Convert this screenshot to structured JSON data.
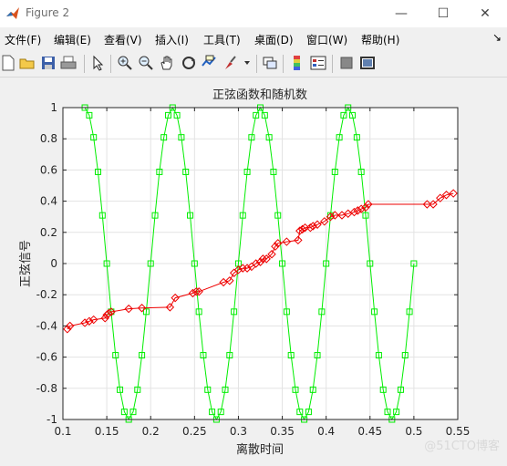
{
  "window": {
    "title": "Figure 2",
    "minimize_glyph": "—",
    "maximize_glyph": "☐",
    "close_glyph": "✕"
  },
  "menu": {
    "items": [
      "文件(F)",
      "编辑(E)",
      "查看(V)",
      "插入(I)",
      "工具(T)",
      "桌面(D)",
      "窗口(W)",
      "帮助(H)"
    ],
    "overflow_glyph": "↘"
  },
  "toolbar": {
    "icons": [
      "new-figure-icon",
      "open-file-icon",
      "save-icon",
      "print-icon",
      "pointer-icon",
      "zoom-in-icon",
      "zoom-out-icon",
      "pan-hand-icon",
      "rotate-3d-icon",
      "data-cursor-icon",
      "brush-icon",
      "link-plot-icon",
      "colorbar-icon",
      "legend-icon",
      "hide-plot-tools-icon",
      "show-plot-tools-icon"
    ]
  },
  "watermark": "@51CTO博客",
  "chart_data": {
    "type": "line",
    "title": "正弦函数和随机数",
    "xlabel": "离散时间",
    "ylabel": "正弦信号",
    "xlim": [
      0.1,
      0.55
    ],
    "ylim": [
      -1,
      1
    ],
    "xticks": [
      0.1,
      0.15,
      0.2,
      0.25,
      0.3,
      0.35,
      0.4,
      0.45,
      0.5,
      0.55
    ],
    "yticks": [
      -1,
      -0.8,
      -0.6,
      -0.4,
      -0.2,
      0,
      0.2,
      0.4,
      0.6,
      0.8,
      1
    ],
    "xtick_labels": [
      "0.1",
      "0.15",
      "0.2",
      "0.25",
      "0.3",
      "0.35",
      "0.4",
      "0.45",
      "0.5",
      "0.55"
    ],
    "ytick_labels": [
      "-1",
      "-0.8",
      "-0.6",
      "-0.4",
      "-0.2",
      "0",
      "0.2",
      "0.4",
      "0.6",
      "0.8",
      "1"
    ],
    "grid": true,
    "series": [
      {
        "color": "#00ee00",
        "marker": "square",
        "x": [
          0.125,
          0.13,
          0.135,
          0.14,
          0.145,
          0.15,
          0.155,
          0.16,
          0.165,
          0.17,
          0.175,
          0.18,
          0.185,
          0.19,
          0.195,
          0.2,
          0.205,
          0.21,
          0.215,
          0.22,
          0.225,
          0.23,
          0.235,
          0.24,
          0.245,
          0.25,
          0.255,
          0.26,
          0.265,
          0.27,
          0.275,
          0.28,
          0.285,
          0.29,
          0.295,
          0.3,
          0.305,
          0.31,
          0.315,
          0.32,
          0.325,
          0.33,
          0.335,
          0.34,
          0.345,
          0.35,
          0.355,
          0.36,
          0.365,
          0.37,
          0.375,
          0.38,
          0.385,
          0.39,
          0.395,
          0.4,
          0.405,
          0.41,
          0.415,
          0.42,
          0.425,
          0.43,
          0.435,
          0.44,
          0.445,
          0.45,
          0.455,
          0.46,
          0.465,
          0.47,
          0.475,
          0.48,
          0.485,
          0.49,
          0.495,
          0.5
        ],
        "y": [
          1,
          0.951,
          0.809,
          0.588,
          0.309,
          0,
          -0.309,
          -0.588,
          -0.809,
          -0.951,
          -1,
          -0.951,
          -0.809,
          -0.588,
          -0.309,
          0,
          0.309,
          0.588,
          0.809,
          0.951,
          1,
          0.951,
          0.809,
          0.588,
          0.309,
          0,
          -0.309,
          -0.588,
          -0.809,
          -0.951,
          -1,
          -0.951,
          -0.809,
          -0.588,
          -0.309,
          0,
          0.309,
          0.588,
          0.809,
          0.951,
          1,
          0.951,
          0.809,
          0.588,
          0.309,
          0,
          -0.309,
          -0.588,
          -0.809,
          -0.951,
          -1,
          -0.951,
          -0.809,
          -0.588,
          -0.309,
          0,
          0.309,
          0.588,
          0.809,
          0.951,
          1,
          0.951,
          0.809,
          0.588,
          0.309,
          0,
          -0.309,
          -0.588,
          -0.809,
          -0.951,
          -1,
          -0.951,
          -0.809,
          -0.588,
          -0.309,
          0
        ]
      },
      {
        "color": "#ee0000",
        "marker": "diamond",
        "x": [
          0.105,
          0.108,
          0.125,
          0.13,
          0.135,
          0.148,
          0.15,
          0.152,
          0.155,
          0.175,
          0.19,
          0.222,
          0.228,
          0.248,
          0.252,
          0.255,
          0.283,
          0.29,
          0.295,
          0.3,
          0.305,
          0.31,
          0.315,
          0.32,
          0.325,
          0.328,
          0.332,
          0.338,
          0.342,
          0.345,
          0.355,
          0.368,
          0.37,
          0.373,
          0.376,
          0.382,
          0.385,
          0.39,
          0.398,
          0.405,
          0.41,
          0.418,
          0.425,
          0.432,
          0.436,
          0.44,
          0.445,
          0.448,
          0.515,
          0.522,
          0.53,
          0.537,
          0.545
        ],
        "y": [
          -0.42,
          -0.4,
          -0.38,
          -0.37,
          -0.36,
          -0.35,
          -0.33,
          -0.32,
          -0.31,
          -0.29,
          -0.285,
          -0.28,
          -0.22,
          -0.19,
          -0.18,
          -0.18,
          -0.12,
          -0.11,
          -0.06,
          -0.04,
          -0.03,
          -0.03,
          -0.02,
          0.0,
          0.01,
          0.03,
          0.03,
          0.06,
          0.11,
          0.13,
          0.14,
          0.15,
          0.21,
          0.22,
          0.23,
          0.23,
          0.24,
          0.25,
          0.27,
          0.3,
          0.31,
          0.31,
          0.32,
          0.33,
          0.34,
          0.35,
          0.36,
          0.38,
          0.38,
          0.38,
          0.42,
          0.44,
          0.45
        ]
      }
    ]
  }
}
